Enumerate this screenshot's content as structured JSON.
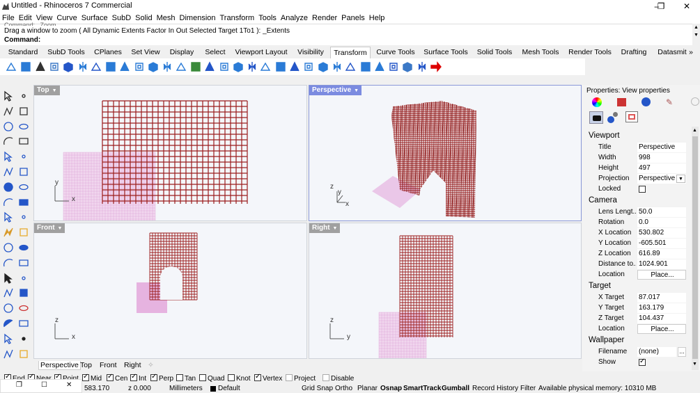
{
  "window": {
    "title": "Untitled - Rhinoceros 7 Commercial",
    "minimize": "–",
    "maximize": "❐",
    "close": "✕"
  },
  "menu": [
    "File",
    "Edit",
    "View",
    "Curve",
    "Surface",
    "SubD",
    "Solid",
    "Mesh",
    "Dimension",
    "Transform",
    "Tools",
    "Analyze",
    "Render",
    "Panels",
    "Help"
  ],
  "command": {
    "history_partial": "Command: _Zoom",
    "history": "Drag a window to zoom ( All  Dynamic  Extents  Factor  In  Out  Selected  Target  1To1 ): _Extents",
    "prompt": "Command:"
  },
  "toolbar_tabs": [
    "Standard",
    "SubD Tools",
    "CPlanes",
    "Set View",
    "Display",
    "Select",
    "Viewport Layout",
    "Visibility",
    "Transform",
    "Curve Tools",
    "Surface Tools",
    "Solid Tools",
    "Mesh Tools",
    "Render Tools",
    "Drafting",
    "Datasmit"
  ],
  "active_tab": "Transform",
  "more_tabs": "»",
  "viewports": {
    "top": {
      "label": "Top"
    },
    "perspective": {
      "label": "Perspective"
    },
    "front": {
      "label": "Front"
    },
    "right": {
      "label": "Right"
    }
  },
  "axis": {
    "x": "x",
    "y": "y",
    "z": "z"
  },
  "viewport_tabs": [
    "Perspective",
    "Top",
    "Front",
    "Right"
  ],
  "add_tab": "✧",
  "osnaps": [
    {
      "label": "End",
      "on": true
    },
    {
      "label": "Near",
      "on": true
    },
    {
      "label": "Point",
      "on": true
    },
    {
      "label": "Mid",
      "on": true
    },
    {
      "label": "Cen",
      "on": true
    },
    {
      "label": "Int",
      "on": true
    },
    {
      "label": "Perp",
      "on": true
    },
    {
      "label": "Tan",
      "on": false
    },
    {
      "label": "Quad",
      "on": false
    },
    {
      "label": "Knot",
      "on": false
    },
    {
      "label": "Vertex",
      "on": true
    },
    {
      "label": "Project",
      "on": false
    },
    {
      "label": "Disable",
      "on": false
    }
  ],
  "status": {
    "coord": "583.170",
    "z": "z 0.000",
    "units": "Millimeters",
    "layer": "Default",
    "grid_snap": "Grid Snap",
    "ortho": "Ortho",
    "planar": "Planar",
    "osnap": "Osnap",
    "smarttrack": "SmartTrack",
    "gumball": "Gumball",
    "record_history": "Record History",
    "filter": "Filter",
    "memory": "Available physical memory: 10310 MB"
  },
  "properties": {
    "header": "Properties: View properties",
    "viewport_section": "Viewport",
    "camera_section": "Camera",
    "target_section": "Target",
    "wallpaper_section": "Wallpaper",
    "title_k": "Title",
    "title_v": "Perspective",
    "width_k": "Width",
    "width_v": "998",
    "height_k": "Height",
    "height_v": "497",
    "projection_k": "Projection",
    "projection_v": "Perspective",
    "locked_k": "Locked",
    "lens_k": "Lens Lengt...",
    "lens_v": "50.0",
    "rotation_k": "Rotation",
    "rotation_v": "0.0",
    "xloc_k": "X Location",
    "xloc_v": "530.802",
    "yloc_k": "Y Location",
    "yloc_v": "-605.501",
    "zloc_k": "Z Location",
    "zloc_v": "616.89",
    "dist_k": "Distance to...",
    "dist_v": "1024.901",
    "location_k": "Location",
    "place_label": "Place...",
    "xt_k": "X Target",
    "xt_v": "87.017",
    "yt_k": "Y Target",
    "yt_v": "163.179",
    "zt_k": "Z Target",
    "zt_v": "104.437",
    "tloc_k": "Location",
    "filename_k": "Filename",
    "filename_v": "(none)",
    "browse_label": "...",
    "show_k": "Show"
  },
  "colors": {
    "grid": "#9b1c1c",
    "pink": "#e6b3e0",
    "accent": "#7b8be0"
  }
}
